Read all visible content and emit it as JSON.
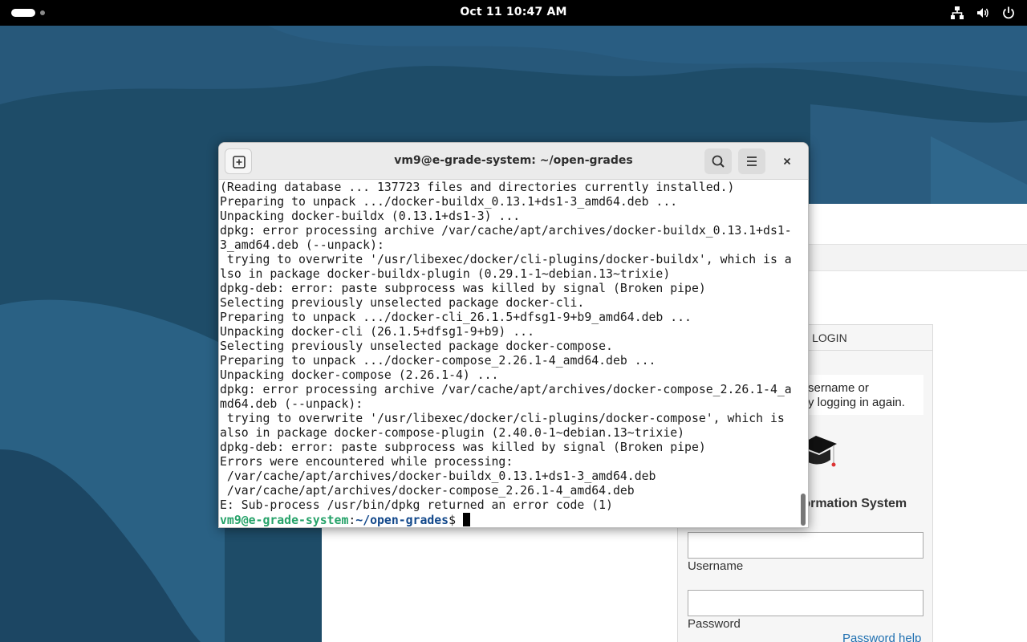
{
  "topbar": {
    "clock": "Oct 11  10:47 AM",
    "icons": [
      "network-icon",
      "volume-icon",
      "power-icon"
    ]
  },
  "browser_login": {
    "header": "IS LOGIN",
    "message_lines": [
      "sername or",
      "y logging in again."
    ],
    "system_title": "formation System",
    "username_label": "Username",
    "password_label": "Password",
    "password_help": "Password help"
  },
  "terminal": {
    "title": "vm9@e-grade-system: ~/open-grades",
    "lines": [
      "(Reading database ... 137723 files and directories currently installed.)",
      "Preparing to unpack .../docker-buildx_0.13.1+ds1-3_amd64.deb ...",
      "Unpacking docker-buildx (0.13.1+ds1-3) ...",
      "dpkg: error processing archive /var/cache/apt/archives/docker-buildx_0.13.1+ds1-",
      "3_amd64.deb (--unpack):",
      " trying to overwrite '/usr/libexec/docker/cli-plugins/docker-buildx', which is a",
      "lso in package docker-buildx-plugin (0.29.1-1~debian.13~trixie)",
      "dpkg-deb: error: paste subprocess was killed by signal (Broken pipe)",
      "Selecting previously unselected package docker-cli.",
      "Preparing to unpack .../docker-cli_26.1.5+dfsg1-9+b9_amd64.deb ...",
      "Unpacking docker-cli (26.1.5+dfsg1-9+b9) ...",
      "Selecting previously unselected package docker-compose.",
      "Preparing to unpack .../docker-compose_2.26.1-4_amd64.deb ...",
      "Unpacking docker-compose (2.26.1-4) ...",
      "dpkg: error processing archive /var/cache/apt/archives/docker-compose_2.26.1-4_a",
      "md64.deb (--unpack):",
      " trying to overwrite '/usr/libexec/docker/cli-plugins/docker-compose', which is",
      "also in package docker-compose-plugin (2.40.0-1~debian.13~trixie)",
      "dpkg-deb: error: paste subprocess was killed by signal (Broken pipe)",
      "Errors were encountered while processing:",
      " /var/cache/apt/archives/docker-buildx_0.13.1+ds1-3_amd64.deb",
      " /var/cache/apt/archives/docker-compose_2.26.1-4_amd64.deb",
      "E: Sub-process /usr/bin/dpkg returned an error code (1)"
    ],
    "prompt": {
      "user_host": "vm9@e-grade-system",
      "separator": ":",
      "path": "~/open-grades",
      "symbol": "$ "
    }
  },
  "colors": {
    "prompt_user": "#26a269",
    "prompt_path": "#12488b",
    "wallpaper": "#1f4e6a"
  }
}
